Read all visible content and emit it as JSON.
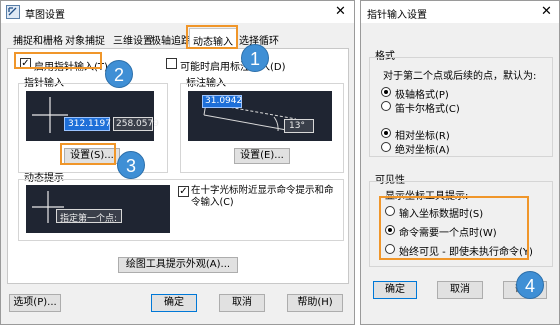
{
  "left_dialog": {
    "title": "草图设置",
    "close_glyph": "✕",
    "tabs": [
      "捕捉和栅格",
      "对象捕捉",
      "三维设置",
      "极轴追踪",
      "动态输入",
      "选择循环"
    ],
    "active_tab": "动态输入",
    "enable_pointer_input": {
      "label": "启用指针输入(T)",
      "checked": true
    },
    "enable_dim_input": {
      "label": "可能时启用标注输入(D)",
      "checked": false
    },
    "pointer_input": {
      "title": "指针输入",
      "value_x": "312.1197",
      "value_y": "258.0579",
      "settings_button": "设置(S)..."
    },
    "dim_input": {
      "title": "标注输入",
      "value_length": "31.0942",
      "value_angle": "13°",
      "settings_button": "设置(E)..."
    },
    "dynamic_prompt": {
      "title": "动态提示",
      "prompt_text": "指定第一个点:",
      "show_near_cursor": {
        "label": "在十字光标附近显示命令提示和命令输入(C)",
        "checked": true
      }
    },
    "appearance_button": "绘图工具提示外观(A)...",
    "footer": {
      "options_button": "选项(P)...",
      "ok_button": "确定",
      "cancel_button": "取消",
      "help_button": "帮助(H)"
    }
  },
  "right_dialog": {
    "title": "指针输入设置",
    "close_glyph": "✕",
    "format_group": {
      "title": "格式",
      "description": "对于第二个点或后续的点，默认为:",
      "radios_a": [
        {
          "label": "极轴格式(P)",
          "selected": true
        },
        {
          "label": "笛卡尔格式(C)",
          "selected": false
        }
      ],
      "radios_b": [
        {
          "label": "相对坐标(R)",
          "selected": true
        },
        {
          "label": "绝对坐标(A)",
          "selected": false
        }
      ]
    },
    "visibility_group": {
      "title": "可见性",
      "description": "显示坐标工具提示:",
      "radios": [
        {
          "label": "输入坐标数据时(S)",
          "selected": false
        },
        {
          "label": "命令需要一个点时(W)",
          "selected": true
        },
        {
          "label": "始终可见 - 即使未执行命令(Y)",
          "selected": false
        }
      ]
    },
    "footer": {
      "ok_button": "确定",
      "cancel_button": "取消",
      "help_button": "帮助"
    }
  },
  "callouts": [
    "1",
    "2",
    "3",
    "4"
  ],
  "colors": {
    "highlight": "#f0962a",
    "badge": "#3f8fd5",
    "preview_bg": "#1f2532",
    "input_blue": "#1e6fd8"
  }
}
